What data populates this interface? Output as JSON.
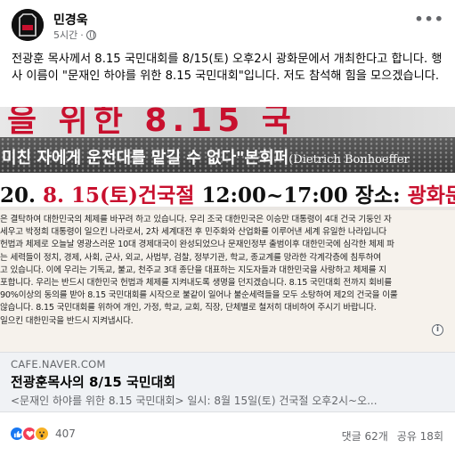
{
  "author": {
    "name": "민경욱",
    "timestamp": "5시간"
  },
  "post": {
    "text": "전광훈 목사께서 8.15 국민대회를 8/15(토) 오후2시 광화문에서 개최한다고 합니다. 행사 이름이 \"문재인 하야를 위한 8.15 국민대회\"입니다. 저도 참석해 힘을 모으겠습니다."
  },
  "image": {
    "banner_top_text": "을 위한 8.15 국",
    "quote": "미친 자에게 운전대를 맡길 수 없다\"본회퍼",
    "quote_small": "(Dietrich Bonhoeffer",
    "date_year": "20.",
    "date_main": " 8. 15(토)건국절",
    "time": " 12:00~17:00",
    "place_label": "  장소:",
    "place_value": " 광화문 이순",
    "body_lines": [
      "은 결탁하여 대한민국의 체제를 바꾸려 하고 있습니다. 우리 조국 대한민국은 이승만 대통령이 4대 건국 기둥인 자",
      "세우고 박정희 대통령이 일으킨 나라로서, 2차 세계대전 후 민주화와 산업화를 이루어낸 세계 유일한 나라입니다",
      "헌법과 체제로 오늘날 영광스러운 10대 경제대국이 완성되었으나 문재인정부 출범이후 대한민국에 심각한 체제 파",
      "는 세력들이 정치, 경제, 사회, 군사, 외교, 사법부, 검찰, 정부기관, 학교, 종교계를 망라한 각계각층에 침투하여",
      "고 있습니다. 이에 우리는 기독교, 불교, 천주교 3대 종단을 대표하는 지도자들과 대한민국을 사랑하고 체제를 지",
      "포합니다. 우리는 반드시 대한민국 헌법과 체제를 지켜내도록 생명을 던지겠습니다. 8.15 국민대회 전까지 회비를",
      "90%이상의 동의를 받아 8.15 국민대회를 시작으로 불같이 일어나 불순세력들을 모두 소탕하여 제2의 건국을 이룰",
      "",
      "않습니다. 8.15 국민대회를 위하여 개인, 가정, 학교, 교회, 직장, 단체별로 철저히 대비하여 주시기 바랍니다.",
      "일으킨 대한민국을 반드시 지켜냅시다."
    ]
  },
  "link": {
    "domain": "CAFE.NAVER.COM",
    "title": "전광훈목사의 8/15 국민대회",
    "description": "<문재인 하야를 위한 8.15 국민대회> 일시: 8월 15일(토) 건국절 오후2시~오..."
  },
  "engagement": {
    "reaction_count": "407",
    "comments": "댓글 62개",
    "shares": "공유 18회"
  },
  "colors": {
    "accent_red": "#c8102e",
    "like_blue": "#1877f2",
    "love_red": "#f33e58",
    "wow_yellow": "#f7b125"
  }
}
